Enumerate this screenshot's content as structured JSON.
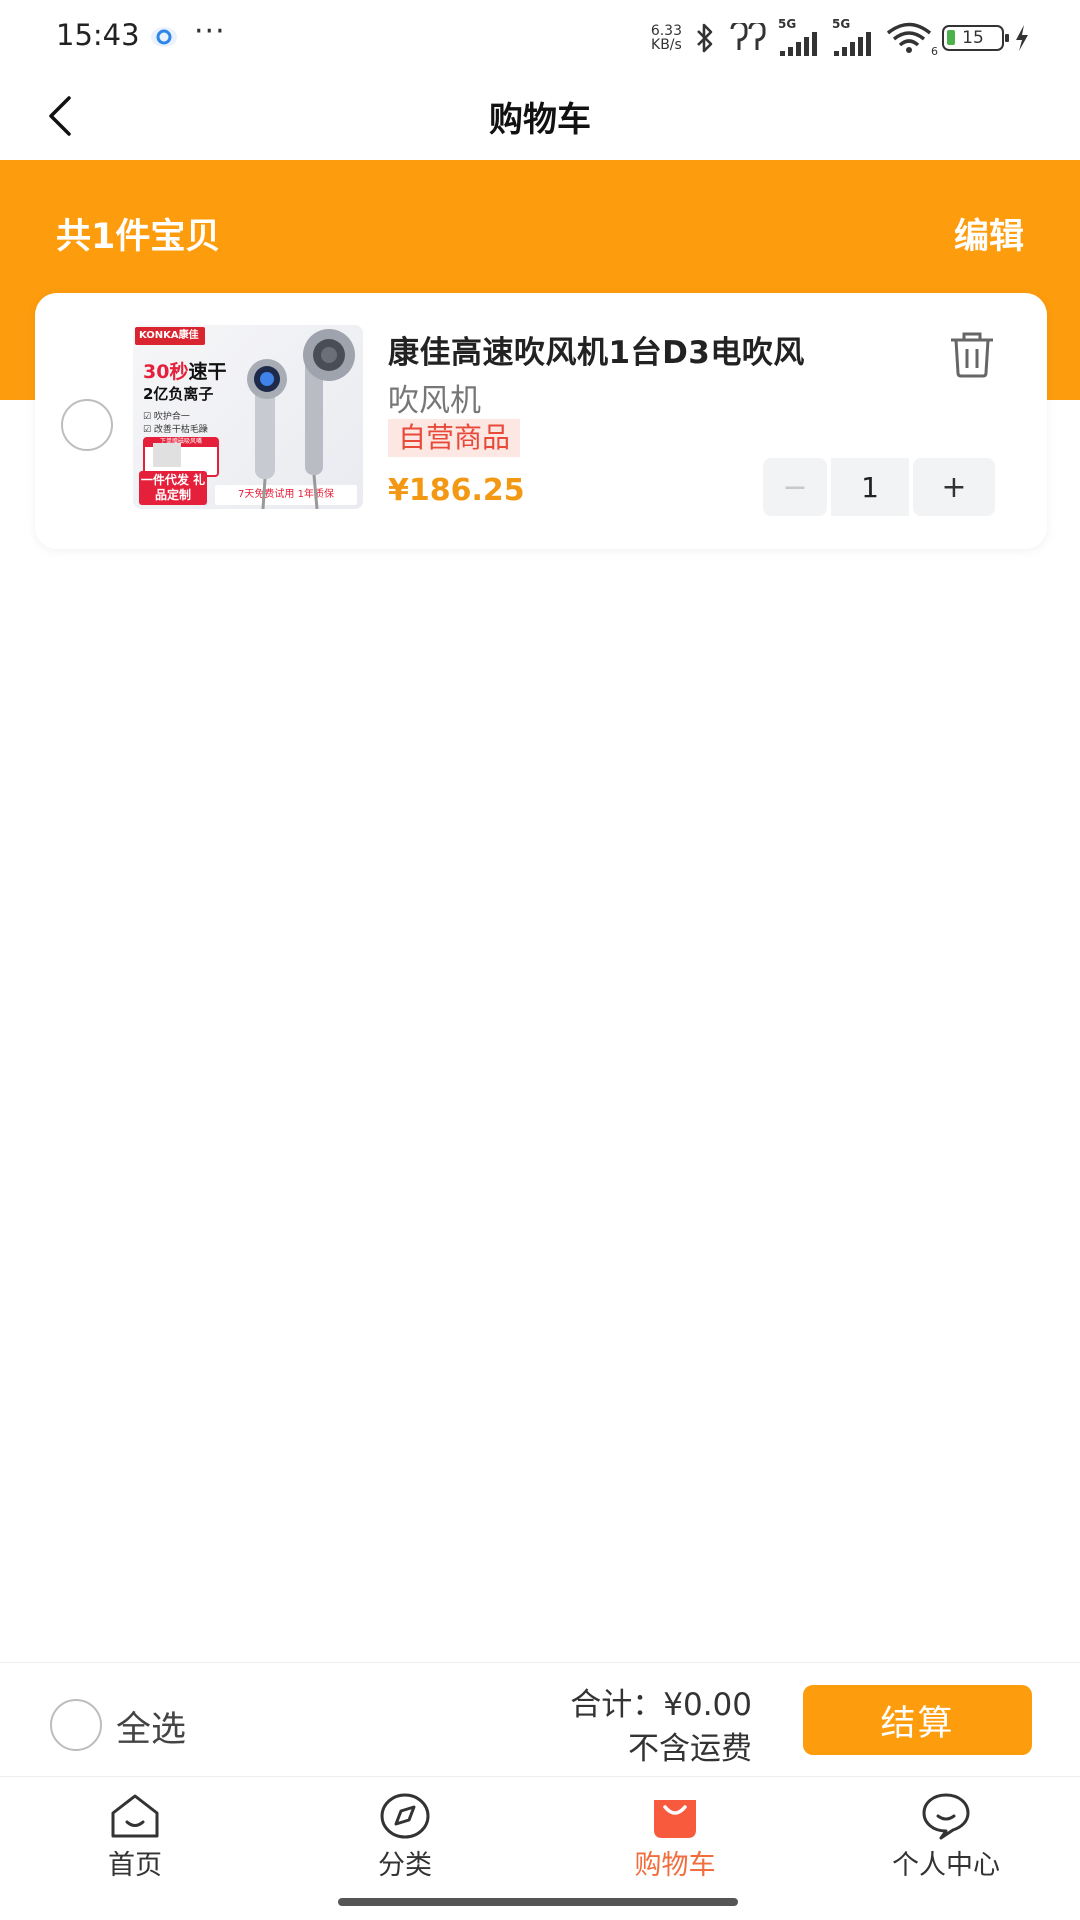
{
  "status_bar": {
    "time": "15:43",
    "more": "···",
    "net_speed_value": "6.33",
    "net_speed_unit": "KB/s",
    "signal_label_1": "5G",
    "signal_label_2": "5G",
    "wifi_level": "6",
    "battery_level": "15",
    "icons": [
      "app-icon",
      "bluetooth-icon",
      "earbuds-icon",
      "signal-icon",
      "wifi-icon",
      "battery-icon",
      "charging-icon"
    ]
  },
  "nav": {
    "title": "购物车",
    "back_icon": "chevron-left-icon"
  },
  "cart_header": {
    "count_label": "共1件宝贝",
    "edit_label": "编辑",
    "accent_color": "#fd9c0d"
  },
  "cart_items": [
    {
      "title": "康佳高速吹风机1台D3电吹风",
      "subtitle": "吹风机",
      "badge": "自营商品",
      "price": "¥186.25",
      "quantity": "1",
      "minus_label": "−",
      "plus_label": "+",
      "selected": false,
      "image": {
        "brand": "KONKA康佳",
        "headline_red": "30秒",
        "headline_black": "速干",
        "subline": "2亿负离子",
        "check_1": "☑ 吹护合一",
        "check_2": "☑ 改善干枯毛躁",
        "box_caption": "下单赠磁吸风嘴",
        "promo": "一件代发 礼品定制",
        "footer": "7天免费试用  1年质保"
      }
    }
  ],
  "checkout": {
    "select_all_label": "全选",
    "total_label": "合计：¥0.00",
    "shipping_note": "不含运费",
    "button_label": "结算"
  },
  "tab_bar": {
    "items": [
      {
        "label": "首页",
        "icon": "home-icon",
        "active": false
      },
      {
        "label": "分类",
        "icon": "compass-icon",
        "active": false
      },
      {
        "label": "购物车",
        "icon": "shopping-bag-icon",
        "active": true
      },
      {
        "label": "个人中心",
        "icon": "chat-bubble-icon",
        "active": false
      }
    ],
    "active_color": "#f26d3d"
  }
}
